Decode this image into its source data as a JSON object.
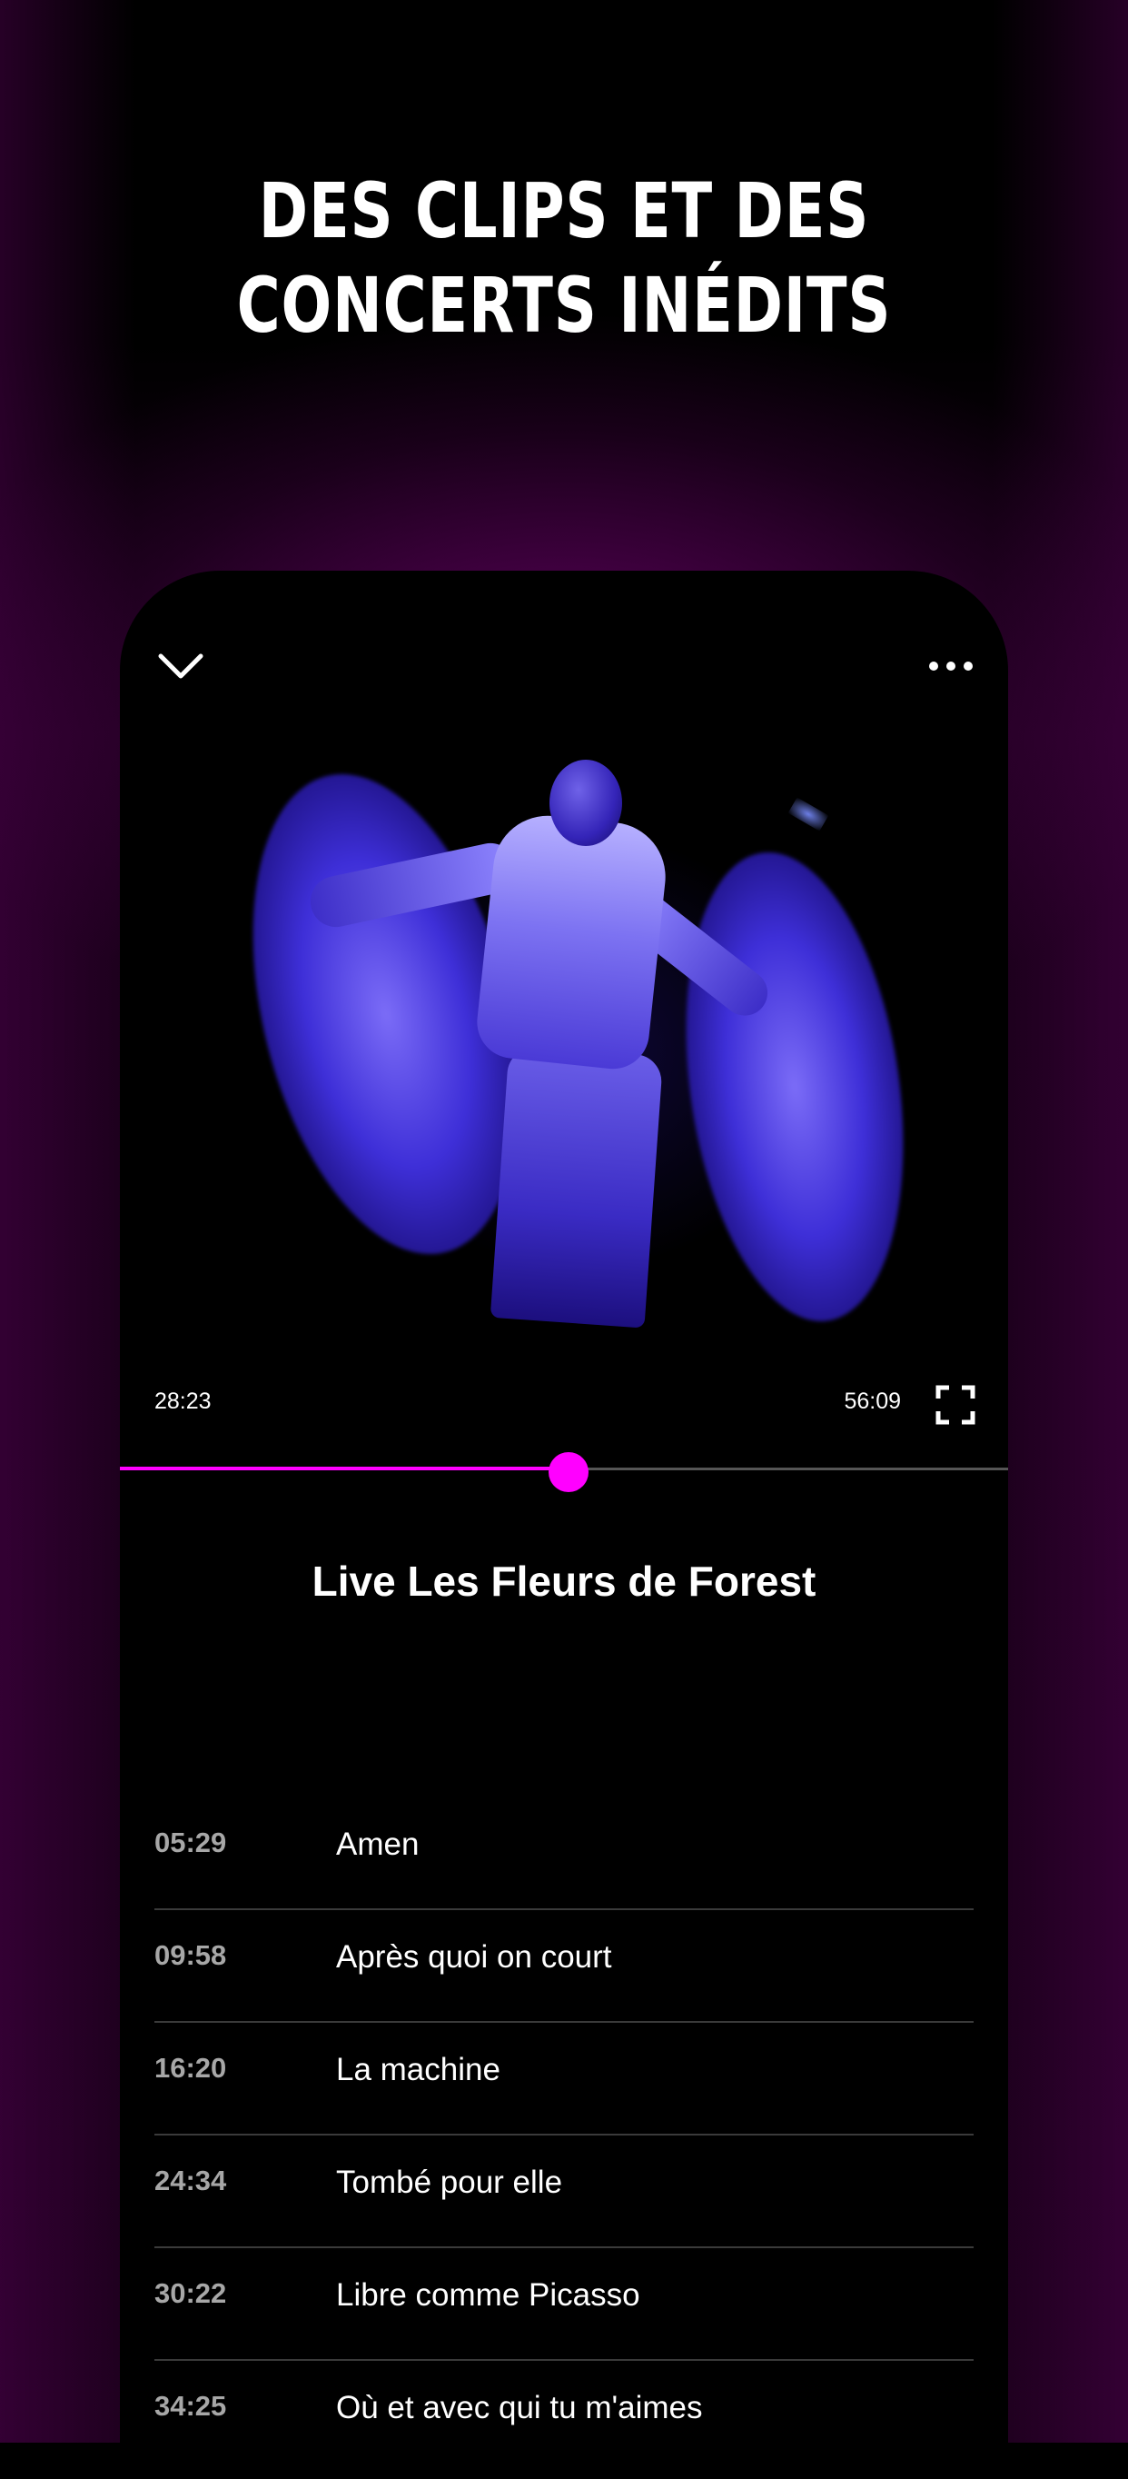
{
  "promo": {
    "headline_line1": "DES CLIPS ET DES",
    "headline_line2": "CONCERTS INÉDITS"
  },
  "player": {
    "top_bar": {
      "collapse_icon": "chevron-down-icon",
      "more_icon": "more-horizontal-icon"
    },
    "current_time": "28:23",
    "total_time": "56:09",
    "progress_fraction": 0.505,
    "fullscreen_icon": "fullscreen-icon",
    "title": "Live Les Fleurs de Forest"
  },
  "tracks": [
    {
      "time": "05:29",
      "title": "Amen"
    },
    {
      "time": "09:58",
      "title": "Après quoi on court"
    },
    {
      "time": "16:20",
      "title": "La machine"
    },
    {
      "time": "24:34",
      "title": "Tombé pour elle"
    },
    {
      "time": "30:22",
      "title": "Libre comme Picasso"
    },
    {
      "time": "34:25",
      "title": "Où et avec qui tu m'aimes"
    }
  ],
  "colors": {
    "accent": "#ff00ff",
    "background": "#000000",
    "glow": "#960096",
    "track_time": "#a7a7a7",
    "divider": "#3a3a3a"
  }
}
